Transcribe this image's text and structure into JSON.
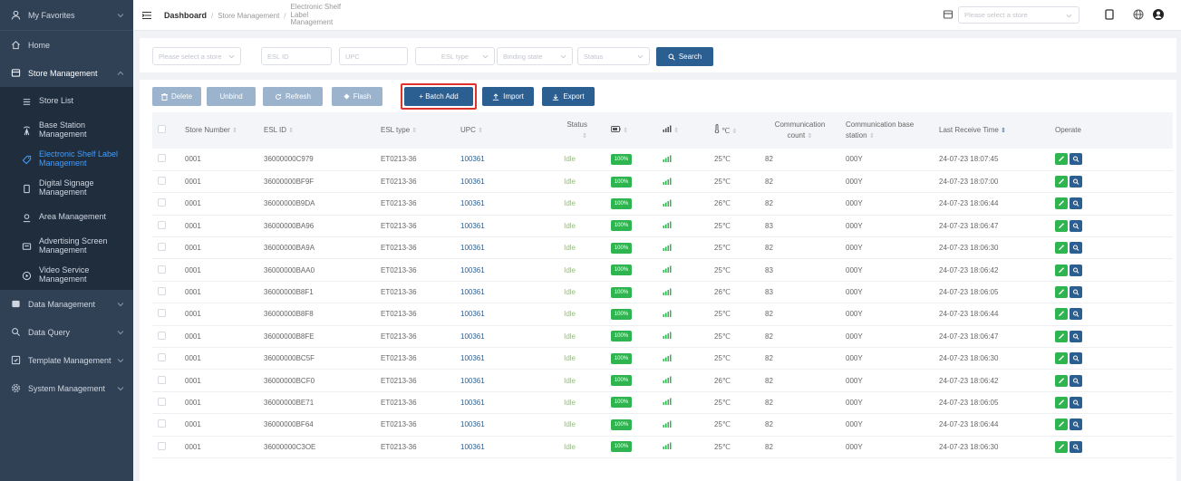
{
  "sidebar": {
    "favorites": "My Favorites",
    "home": "Home",
    "store_management": "Store Management",
    "sub_items": [
      {
        "label": "Store List",
        "icon": "list-icon"
      },
      {
        "label": "Base Station Management",
        "icon": "antenna-icon"
      },
      {
        "label": "Electronic Shelf Label Management",
        "icon": "tag-icon",
        "active": true
      },
      {
        "label": "Digital Signage Management",
        "icon": "monitor-icon"
      },
      {
        "label": "Area Management",
        "icon": "location-icon"
      },
      {
        "label": "Advertising Screen Management",
        "icon": "screen-icon"
      },
      {
        "label": "Video Service Management",
        "icon": "play-icon"
      }
    ],
    "data_management": "Data Management",
    "data_query": "Data Query",
    "template_management": "Template Management",
    "system_management": "System Management"
  },
  "header": {
    "breadcrumb": [
      "Dashboard",
      "Store Management",
      "Electronic Shelf Label Management"
    ],
    "store_placeholder": "Please select a store"
  },
  "filters": {
    "store": "Please select a store",
    "esl_id": "ESL ID",
    "upc": "UPC",
    "esl_type": "ESL type",
    "binding_state": "Binding state",
    "status": "Status",
    "search": "Search"
  },
  "toolbar": {
    "delete": "Delete",
    "unbind": "Unbind",
    "refresh": "Refresh",
    "flash": "Flash",
    "batch_add": "+ Batch Add",
    "import": "Import",
    "export": "Export"
  },
  "table": {
    "headers": {
      "store_number": "Store Number",
      "esl_id": "ESL ID",
      "esl_type": "ESL type",
      "upc": "UPC",
      "status": "Status",
      "temp": "℃",
      "comm_count": "Communication count",
      "comm_base": "Communication base station",
      "last_receive": "Last Receive Time",
      "operate": "Operate"
    },
    "rows": [
      {
        "store": "0001",
        "esl_id": "36000000C979",
        "type": "ET0213-36",
        "upc": "100361",
        "status": "Idle",
        "battery": "100%",
        "temp": "25℃",
        "count": "82",
        "base": "000Y",
        "time": "24-07-23 18:07:45"
      },
      {
        "store": "0001",
        "esl_id": "36000000BF9F",
        "type": "ET0213-36",
        "upc": "100361",
        "status": "Idle",
        "battery": "100%",
        "temp": "25℃",
        "count": "82",
        "base": "000Y",
        "time": "24-07-23 18:07:00"
      },
      {
        "store": "0001",
        "esl_id": "36000000B9DA",
        "type": "ET0213-36",
        "upc": "100361",
        "status": "Idle",
        "battery": "100%",
        "temp": "26℃",
        "count": "82",
        "base": "000Y",
        "time": "24-07-23 18:06:44"
      },
      {
        "store": "0001",
        "esl_id": "36000000BA96",
        "type": "ET0213-36",
        "upc": "100361",
        "status": "Idle",
        "battery": "100%",
        "temp": "25℃",
        "count": "83",
        "base": "000Y",
        "time": "24-07-23 18:06:47"
      },
      {
        "store": "0001",
        "esl_id": "36000000BA9A",
        "type": "ET0213-36",
        "upc": "100361",
        "status": "Idle",
        "battery": "100%",
        "temp": "25℃",
        "count": "82",
        "base": "000Y",
        "time": "24-07-23 18:06:30"
      },
      {
        "store": "0001",
        "esl_id": "36000000BAA0",
        "type": "ET0213-36",
        "upc": "100361",
        "status": "Idle",
        "battery": "100%",
        "temp": "25℃",
        "count": "83",
        "base": "000Y",
        "time": "24-07-23 18:06:42"
      },
      {
        "store": "0001",
        "esl_id": "36000000B8F1",
        "type": "ET0213-36",
        "upc": "100361",
        "status": "Idle",
        "battery": "100%",
        "temp": "26℃",
        "count": "83",
        "base": "000Y",
        "time": "24-07-23 18:06:05"
      },
      {
        "store": "0001",
        "esl_id": "36000000B8F8",
        "type": "ET0213-36",
        "upc": "100361",
        "status": "Idle",
        "battery": "100%",
        "temp": "25℃",
        "count": "82",
        "base": "000Y",
        "time": "24-07-23 18:06:44"
      },
      {
        "store": "0001",
        "esl_id": "36000000B8FE",
        "type": "ET0213-36",
        "upc": "100361",
        "status": "Idle",
        "battery": "100%",
        "temp": "25℃",
        "count": "82",
        "base": "000Y",
        "time": "24-07-23 18:06:47"
      },
      {
        "store": "0001",
        "esl_id": "36000000BC5F",
        "type": "ET0213-36",
        "upc": "100361",
        "status": "Idle",
        "battery": "100%",
        "temp": "25℃",
        "count": "82",
        "base": "000Y",
        "time": "24-07-23 18:06:30"
      },
      {
        "store": "0001",
        "esl_id": "36000000BCF0",
        "type": "ET0213-36",
        "upc": "100361",
        "status": "Idle",
        "battery": "100%",
        "temp": "26℃",
        "count": "82",
        "base": "000Y",
        "time": "24-07-23 18:06:42"
      },
      {
        "store": "0001",
        "esl_id": "36000000BE71",
        "type": "ET0213-36",
        "upc": "100361",
        "status": "Idle",
        "battery": "100%",
        "temp": "25℃",
        "count": "82",
        "base": "000Y",
        "time": "24-07-23 18:06:05"
      },
      {
        "store": "0001",
        "esl_id": "36000000BF64",
        "type": "ET0213-36",
        "upc": "100361",
        "status": "Idle",
        "battery": "100%",
        "temp": "25℃",
        "count": "82",
        "base": "000Y",
        "time": "24-07-23 18:06:44"
      },
      {
        "store": "0001",
        "esl_id": "36000000C3OE",
        "type": "ET0213-36",
        "upc": "100361",
        "status": "Idle",
        "battery": "100%",
        "temp": "25℃",
        "count": "82",
        "base": "000Y",
        "time": "24-07-23 18:06:30"
      }
    ]
  },
  "colors": {
    "sidebar_bg": "#304156",
    "submenu_bg": "#1f2d3d",
    "primary": "#2c5f91",
    "active_menu": "#409eff",
    "battery_green": "#2fb550",
    "idle_green": "#7ed04b",
    "highlight_red": "#e0322c"
  }
}
